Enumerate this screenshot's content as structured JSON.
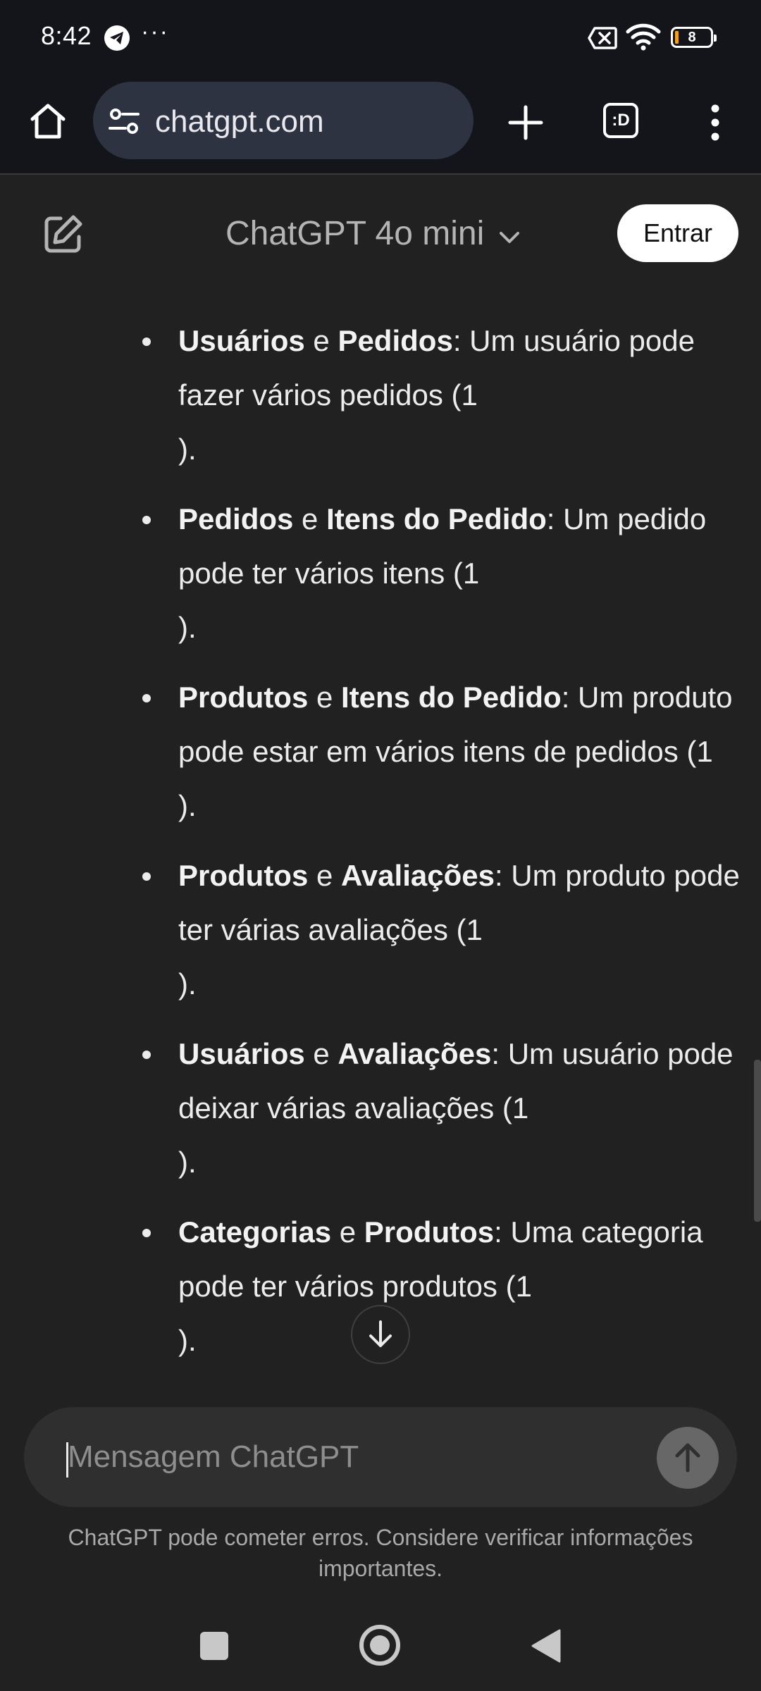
{
  "status_bar": {
    "time": "8:42",
    "overflow": "···",
    "battery_level": "8",
    "icons": [
      "telegram-icon",
      "no-sim-icon",
      "wifi-icon",
      "battery-icon"
    ]
  },
  "browser": {
    "url": "chatgpt.com",
    "tab_switcher_label": ":D"
  },
  "header": {
    "model_name": "ChatGPT 4o mini",
    "login_label": "Entrar"
  },
  "message": {
    "items": [
      {
        "a": "Usuários",
        "joiner": " e ",
        "b": "Pedidos",
        "desc": ": Um usuário pode fazer vários pedidos (1",
        "close": ")."
      },
      {
        "a": "Pedidos",
        "joiner": " e ",
        "b": "Itens do Pedido",
        "desc": ": Um pedido pode ter vários itens (1",
        "close": ")."
      },
      {
        "a": "Produtos",
        "joiner": " e ",
        "b": "Itens do Pedido",
        "desc": ": Um produto pode estar em vários itens de pedidos (1",
        "close": ")."
      },
      {
        "a": "Produtos",
        "joiner": " e ",
        "b": "Avaliações",
        "desc": ": Um produto pode ter várias avaliações (1",
        "close": ")."
      },
      {
        "a": "Usuários",
        "joiner": " e ",
        "b": "Avaliações",
        "desc": ": Um usuário pode deixar várias avaliações (1",
        "close": ")."
      },
      {
        "a": "Categorias",
        "joiner": " e ",
        "b": "Produtos",
        "desc": ": Uma categoria pode ter vários produtos (1",
        "close": ")."
      }
    ]
  },
  "composer": {
    "placeholder": "Mensagem ChatGPT",
    "disclaimer": "ChatGPT pode cometer erros. Considere verificar informações importantes."
  },
  "colors": {
    "background": "#212121",
    "browser_bar": "#14151b",
    "url_pill": "#2e3342",
    "composer": "#2f2f2f",
    "send_button": "#676767",
    "battery_low": "#f0a023"
  }
}
